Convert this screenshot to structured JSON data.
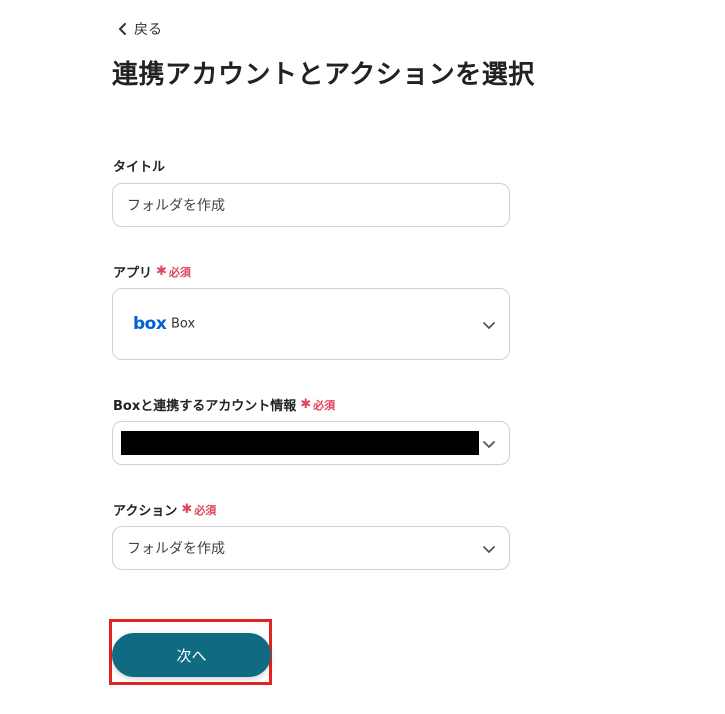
{
  "back": {
    "label": "戻る"
  },
  "page": {
    "title": "連携アカウントとアクションを選択"
  },
  "required": {
    "mark": "✱",
    "text": "必須"
  },
  "fields": {
    "title": {
      "label": "タイトル",
      "value": "フォルダを作成"
    },
    "app": {
      "label": "アプリ",
      "logo_text": "box",
      "value": "Box"
    },
    "account": {
      "label": "Boxと連携するアカウント情報"
    },
    "action": {
      "label": "アクション",
      "value": "フォルダを作成"
    }
  },
  "next": {
    "label": "次へ"
  },
  "colors": {
    "primary_button": "#0f6a82",
    "required": "#e0465a",
    "box_brand": "#0061d5",
    "highlight": "#e02424"
  }
}
